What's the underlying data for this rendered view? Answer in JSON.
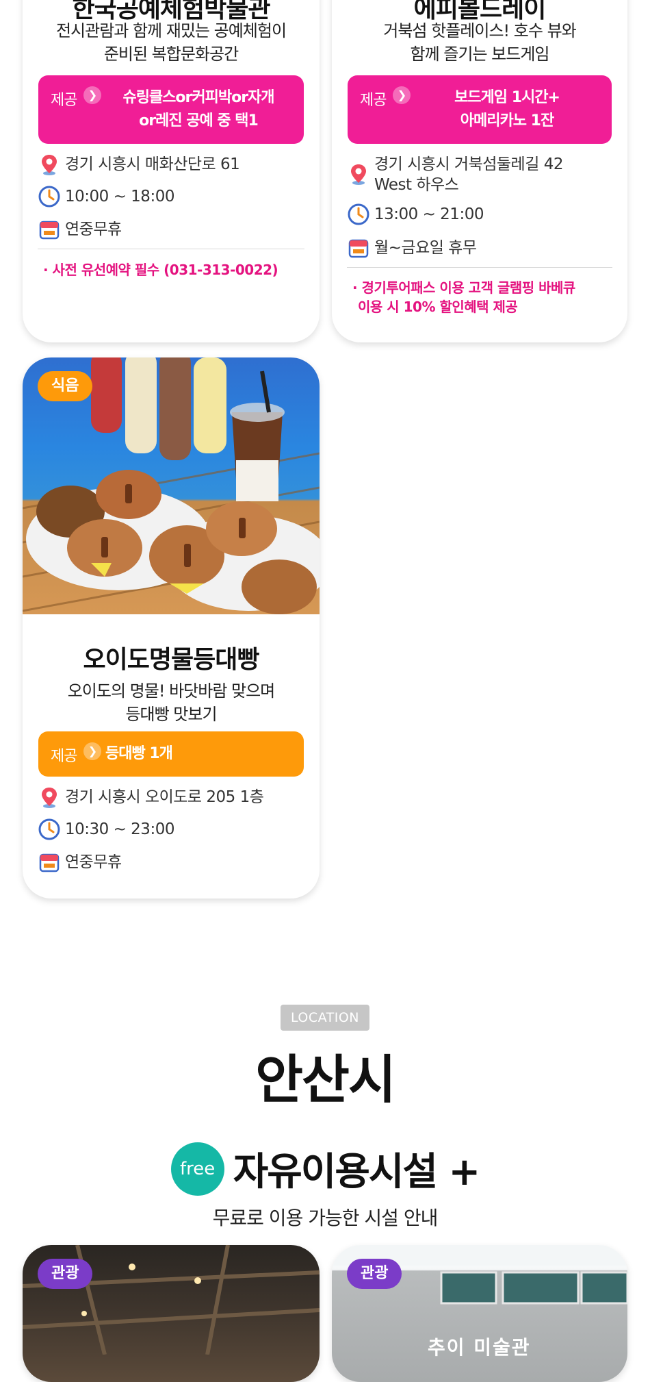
{
  "cards": {
    "craft": {
      "title": "한국공예체험박물관",
      "desc": [
        "전시관람과 함께 재밌는 공예체험이",
        "준비된 복합문화공간"
      ],
      "offer_label": "제공",
      "offer_text": [
        "슈링클스or커피박or자개",
        "or레진 공예 중 택1"
      ],
      "address": "경기 시흥시 매화산단로 61",
      "hours": "10:00 ~ 18:00",
      "closed": "연중무휴",
      "note": "· 사전 유선예약 필수 (031-313-0022)"
    },
    "boardgame": {
      "title": "에피볼드레이",
      "desc": [
        "거북섬 핫플레이스! 호수 뷰와",
        "함께 즐기는 보드게임"
      ],
      "offer_label": "제공",
      "offer_text": [
        "보드게임 1시간+",
        "아메리카노 1잔"
      ],
      "address": [
        "경기 시흥시 거북섬둘레길 42",
        "West 하우스"
      ],
      "hours": "13:00 ~ 21:00",
      "closed": "월~금요일 휴무",
      "note": [
        "· 경기투어패스 이용 고객 글램핑 바베큐",
        "이용 시 10% 할인혜택 제공"
      ]
    },
    "bread": {
      "badge": "식음",
      "title": "오이도명물등대빵",
      "desc": [
        "오이도의 명물! 바닷바람 맞으며",
        "등대빵 맛보기"
      ],
      "offer_label": "제공",
      "offer_text": "등대빵 1개",
      "address": "경기 시흥시 오이도로 205 1층",
      "hours": "10:30 ~ 23:00",
      "closed": "연중무휴"
    }
  },
  "section": {
    "location_tag": "LOCATION",
    "city": "안산시",
    "free_badge": "free",
    "free_title": "자유이용시설 +",
    "free_subtitle": "무료로 이용 가능한 시설 안내"
  },
  "bottom_cards": [
    {
      "badge": "관광"
    },
    {
      "badge": "관광",
      "sign_text": "추이 미술관"
    }
  ],
  "colors": {
    "pink": "#f01e96",
    "orange": "#fe9a0a",
    "teal": "#15b8a6",
    "purple": "#7b3cc8",
    "note_pink": "#e4127f"
  },
  "icons": [
    "location-pin-icon",
    "clock-icon",
    "calendar-icon",
    "chevron-right-icon"
  ]
}
